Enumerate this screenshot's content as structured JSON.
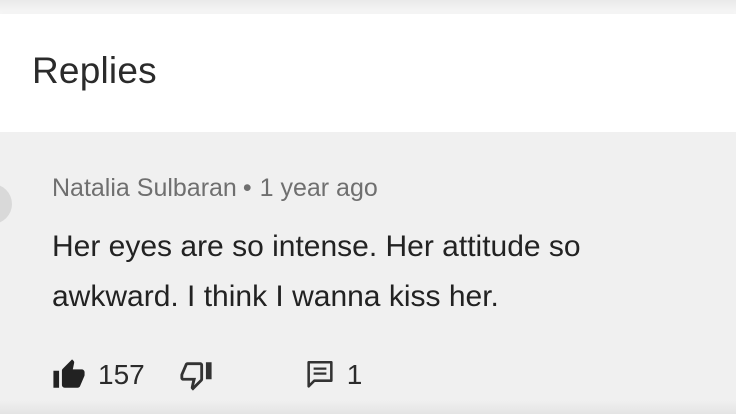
{
  "header": {
    "title": "Replies"
  },
  "comment": {
    "author": "Natalia Sulbaran",
    "separator": "•",
    "timestamp": "1 year ago",
    "text": "Her eyes are so intense. Her attitude so awkward. I think I wanna kiss her.",
    "likes": "157",
    "replies": "1",
    "icons": {
      "like": "thumbs-up-icon",
      "dislike": "thumbs-down-icon",
      "reply": "comment-icon"
    }
  },
  "colors": {
    "header_bg": "#ffffff",
    "content_bg": "#f0f0f0",
    "meta_text": "#6f6f6f",
    "body_text": "#222222"
  }
}
